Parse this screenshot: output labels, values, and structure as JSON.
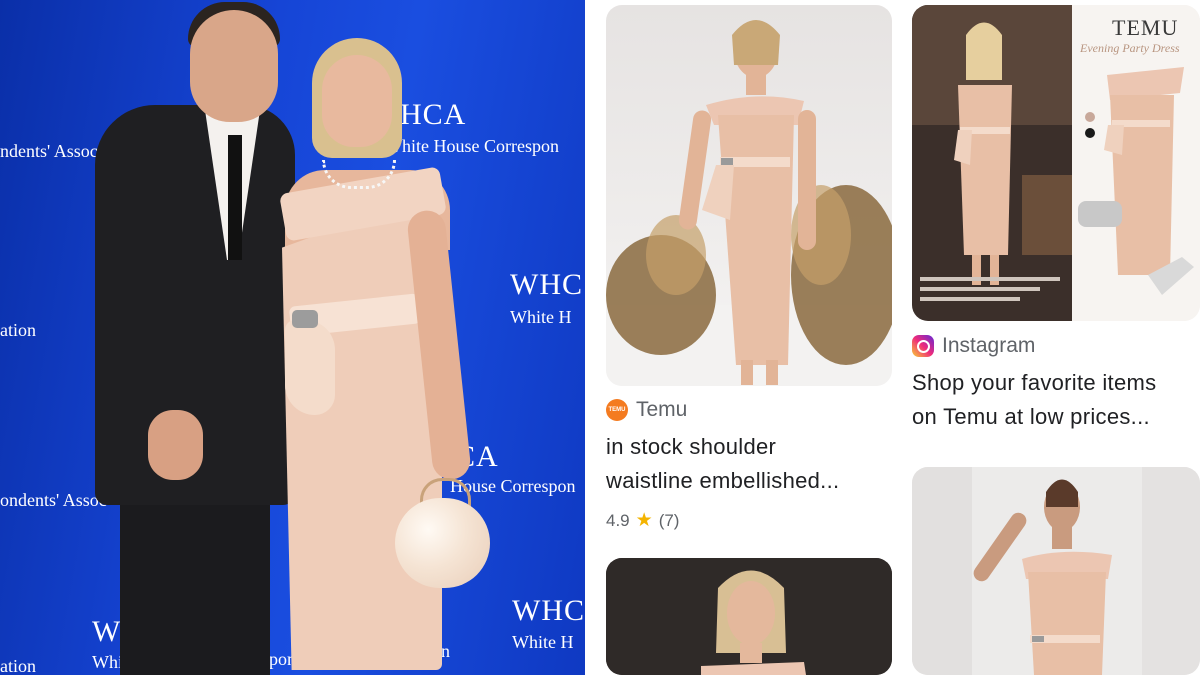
{
  "photo": {
    "backdrop_text": {
      "line1": "HCA",
      "line2": "White House Correspon",
      "line3": "ndents' Assoc",
      "line4": "WHC",
      "line5": "White H",
      "line6": "ation",
      "line7": "CA",
      "line8": "House Correspon",
      "line9": "ondents' Assoc",
      "line10": "WHC",
      "line11": "White H",
      "line12": "WH",
      "line13": "Whit",
      "line14": "respon",
      "line15": "ation",
      "line16": "on"
    },
    "colors": {
      "backdrop": "#1645d6",
      "dress": "#efcdb9",
      "suit": "#1f1f22"
    }
  },
  "results": [
    {
      "source": "Temu",
      "source_icon": "temu-logo-icon",
      "title_line1": "in stock shoulder",
      "title_line2": "waistline embellished...",
      "rating": "4.9",
      "reviews": "(7)"
    },
    {
      "source": "Instagram",
      "source_icon": "instagram-logo-icon",
      "title_line1": "Shop your favorite items",
      "title_line2": "on Temu at low prices...",
      "image_text": {
        "brand": "TEMU",
        "subtitle": "Evening Party Dress"
      }
    },
    {
      "source": "",
      "title_line1": ""
    },
    {
      "source": "",
      "title_line1": ""
    }
  ],
  "colors": {
    "accent_star": "#f4b400",
    "text_primary": "#202124",
    "text_secondary": "#5f6368"
  }
}
